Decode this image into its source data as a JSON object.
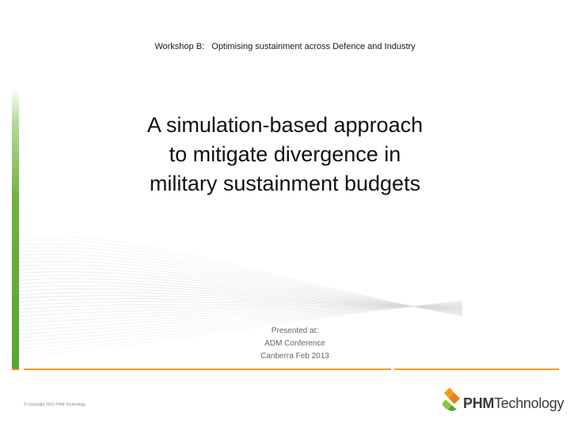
{
  "header": {
    "workshop": "Workshop B:   Optimising sustainment across Defence and Industry"
  },
  "title": {
    "line1": "A simulation-based approach",
    "line2": "to mitigate divergence in",
    "line3": "military sustainment budgets"
  },
  "presented": {
    "line1": "Presented at:",
    "line2": "ADM Conference",
    "line3": "Canberra Feb 2013"
  },
  "footer": {
    "copyright": "© Copyright 2010 PHM Technology",
    "logo_bold": "PHM",
    "logo_regular": "Technology"
  },
  "colors": {
    "accent_green": "#6fb23f",
    "accent_orange": "#f39a1f"
  }
}
